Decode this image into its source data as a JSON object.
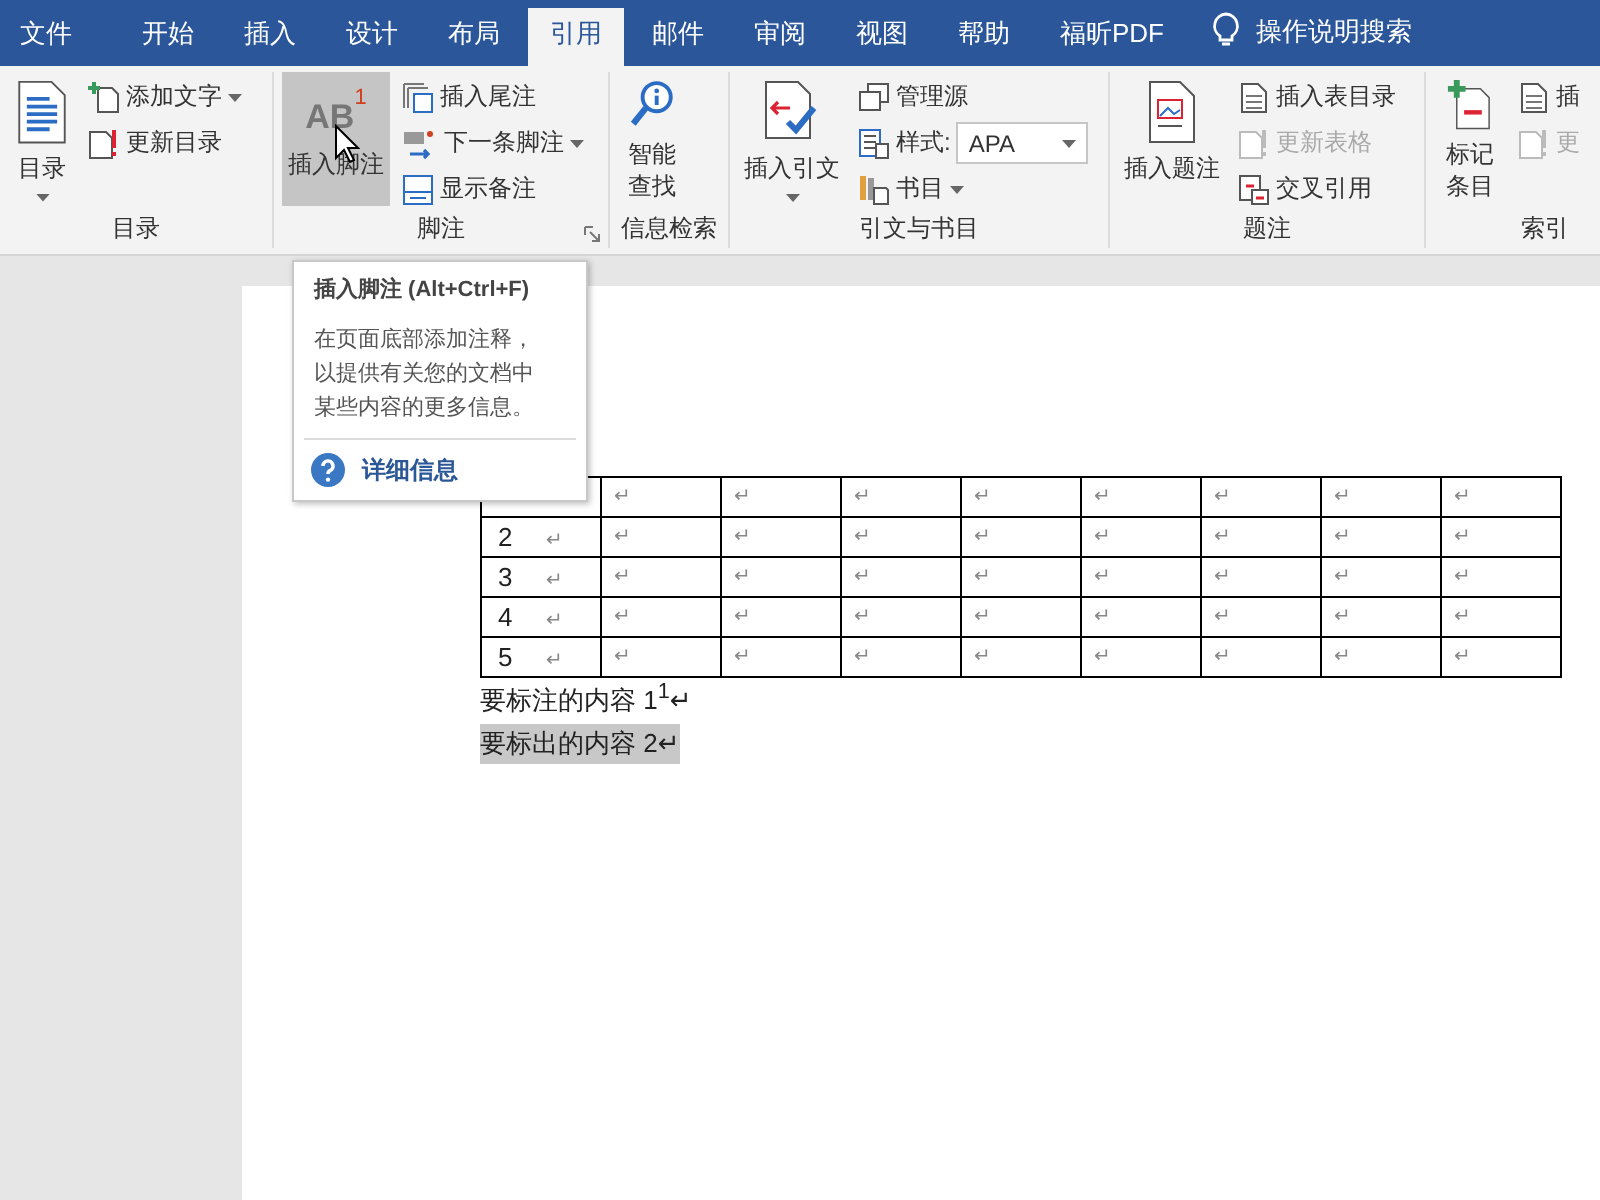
{
  "tabs": [
    {
      "label": "文件",
      "selected": false
    },
    {
      "label": "开始",
      "selected": false
    },
    {
      "label": "插入",
      "selected": false
    },
    {
      "label": "设计",
      "selected": false
    },
    {
      "label": "布局",
      "selected": false
    },
    {
      "label": "引用",
      "selected": true
    },
    {
      "label": "邮件",
      "selected": false
    },
    {
      "label": "审阅",
      "selected": false
    },
    {
      "label": "视图",
      "selected": false
    },
    {
      "label": "帮助",
      "selected": false
    },
    {
      "label": "福昕PDF",
      "selected": false
    }
  ],
  "tell_me": {
    "placeholder": "操作说明搜索"
  },
  "ribbon_groups": [
    {
      "label": "目录",
      "launcher": false,
      "items": [
        {
          "kind": "large",
          "label": "目录",
          "caret": true,
          "highlighted": false
        },
        {
          "kind": "small",
          "label": "添加文字",
          "dropdown": true,
          "disabled": false
        },
        {
          "kind": "small",
          "label": "更新目录",
          "dropdown": false,
          "disabled": false
        }
      ]
    },
    {
      "label": "脚注",
      "launcher": true,
      "items": [
        {
          "kind": "large",
          "label": "插入脚注",
          "caret": false,
          "highlighted": true,
          "icon_text": "AB",
          "icon_mark": "1"
        },
        {
          "kind": "small",
          "label": "插入尾注",
          "dropdown": false,
          "disabled": false
        },
        {
          "kind": "small",
          "label": "下一条脚注",
          "dropdown": true,
          "disabled": false
        },
        {
          "kind": "small",
          "label": "显示备注",
          "dropdown": false,
          "disabled": false
        }
      ]
    },
    {
      "label": "信息检索",
      "launcher": false,
      "items": [
        {
          "kind": "stacked",
          "label": "智能查找",
          "caret": false,
          "highlighted": false
        }
      ]
    },
    {
      "label": "引文与书目",
      "launcher": false,
      "items": [
        {
          "kind": "large",
          "label": "插入引文",
          "caret": true,
          "highlighted": false
        },
        {
          "kind": "small",
          "label": "管理源",
          "dropdown": false,
          "disabled": false
        },
        {
          "kind": "select",
          "label": "样式:",
          "value": "APA"
        },
        {
          "kind": "small",
          "label": "书目",
          "dropdown": true,
          "disabled": false
        }
      ]
    },
    {
      "label": "题注",
      "launcher": false,
      "items": [
        {
          "kind": "large",
          "label": "插入题注",
          "caret": false,
          "highlighted": false
        },
        {
          "kind": "small",
          "label": "插入表目录",
          "dropdown": false,
          "disabled": false
        },
        {
          "kind": "small",
          "label": "更新表格",
          "dropdown": false,
          "disabled": true
        },
        {
          "kind": "small",
          "label": "交叉引用",
          "dropdown": false,
          "disabled": false
        }
      ]
    },
    {
      "label": "索引",
      "launcher": false,
      "items": [
        {
          "kind": "stacked",
          "label": "标记条目",
          "caret": false,
          "highlighted": false
        },
        {
          "kind": "small",
          "label": "插",
          "dropdown": false,
          "disabled": false
        },
        {
          "kind": "small",
          "label": "更",
          "dropdown": false,
          "disabled": true
        }
      ]
    }
  ],
  "tooltip": {
    "title": "插入脚注 (Alt+Ctrl+F)",
    "body": "在页面底部添加注释，以提供有关您的文档中某些内容的更多信息。",
    "link": "详细信息"
  },
  "table": {
    "rows": [
      {
        "cells": [
          "↵",
          "↵",
          "↵",
          "↵",
          "↵",
          "↵",
          "↵",
          "↵"
        ]
      },
      {
        "number": "2",
        "first_mark": "↵",
        "cells": [
          "↵",
          "↵",
          "↵",
          "↵",
          "↵",
          "↵",
          "↵",
          "↵"
        ]
      },
      {
        "number": "3",
        "first_mark": "↵",
        "cells": [
          "↵",
          "↵",
          "↵",
          "↵",
          "↵",
          "↵",
          "↵",
          "↵"
        ]
      },
      {
        "number": "4",
        "first_mark": "↵",
        "cells": [
          "↵",
          "↵",
          "↵",
          "↵",
          "↵",
          "↵",
          "↵",
          "↵"
        ]
      },
      {
        "number": "5",
        "first_mark": "↵",
        "cells": [
          "↵",
          "↵",
          "↵",
          "↵",
          "↵",
          "↵",
          "↵",
          "↵"
        ]
      }
    ]
  },
  "paragraphs": [
    {
      "text": "要标注的内容 1$^{1}$↵",
      "highlighted": false
    },
    {
      "text": "要标出的内容 2↵",
      "highlighted": true
    }
  ]
}
